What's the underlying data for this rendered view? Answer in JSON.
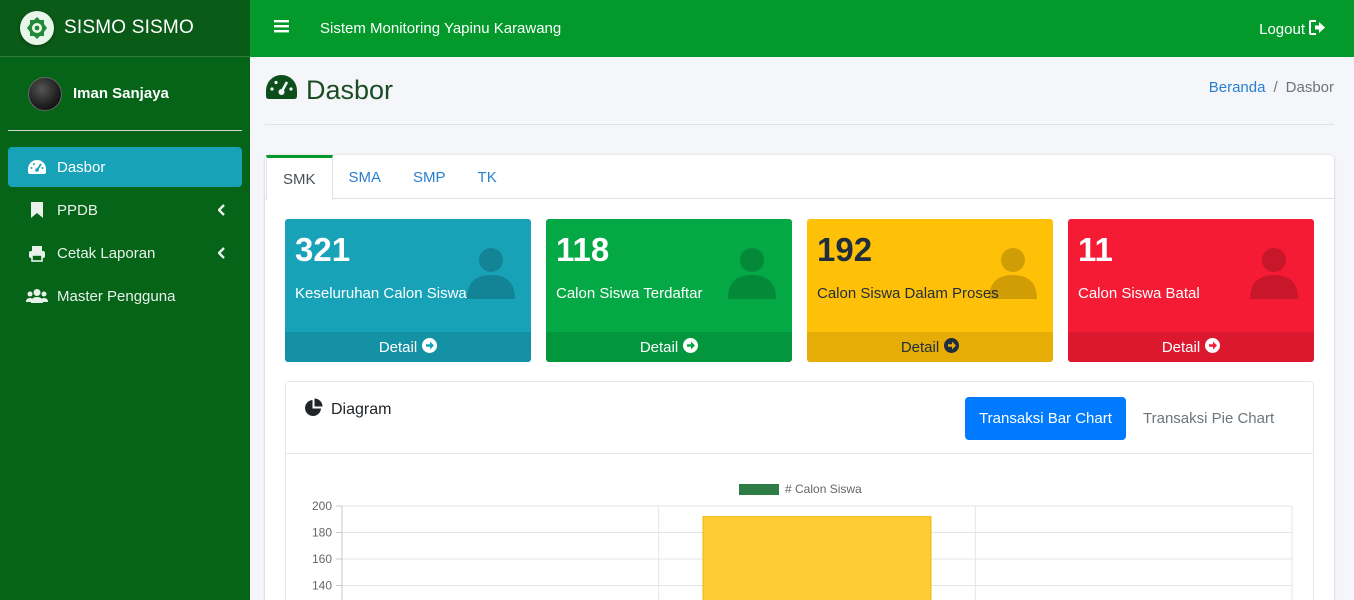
{
  "brand": {
    "title": "SISMO SISMO"
  },
  "user": {
    "name": "Iman Sanjaya"
  },
  "sidebar": {
    "items": [
      {
        "label": "Dasbor",
        "icon": "tachometer-icon",
        "active": true
      },
      {
        "label": "PPDB",
        "icon": "bookmark-icon"
      },
      {
        "label": "Cetak Laporan",
        "icon": "printer-icon"
      },
      {
        "label": "Master Pengguna",
        "icon": "users-icon"
      }
    ]
  },
  "topnav": {
    "title": "Sistem Monitoring Yapinu Karawang",
    "logout": "Logout"
  },
  "page": {
    "title": "Dasbor"
  },
  "breadcrumb": {
    "home": "Beranda",
    "sep": "/",
    "current": "Dasbor"
  },
  "tabs": [
    "SMK",
    "SMA",
    "SMP",
    "TK"
  ],
  "stats": [
    {
      "value": "321",
      "label": "Keseluruhan Calon Siswa",
      "detail": "Detail",
      "color": "#17a2b8"
    },
    {
      "value": "118",
      "label": "Calon Siswa Terdaftar",
      "detail": "Detail",
      "color": "#04a844"
    },
    {
      "value": "192",
      "label": "Calon Siswa Dalam Proses",
      "detail": "Detail",
      "color": "#ffc107"
    },
    {
      "value": "11",
      "label": "Calon Siswa Batal",
      "detail": "Detail",
      "color": "#f51b35"
    }
  ],
  "diagram": {
    "title": "Diagram",
    "btn_bar": "Transaksi Bar Chart",
    "btn_pie": "Transaksi Pie Chart"
  },
  "chart_data": {
    "type": "bar",
    "legend": "# Calon Siswa",
    "legend_color": "#2e7d46",
    "bar_color": "#ffcd33",
    "yticks": [
      200,
      180,
      160,
      140
    ],
    "ylim": [
      0,
      200
    ],
    "categories": [
      "",
      "",
      ""
    ],
    "values": [
      null,
      192,
      null
    ]
  }
}
